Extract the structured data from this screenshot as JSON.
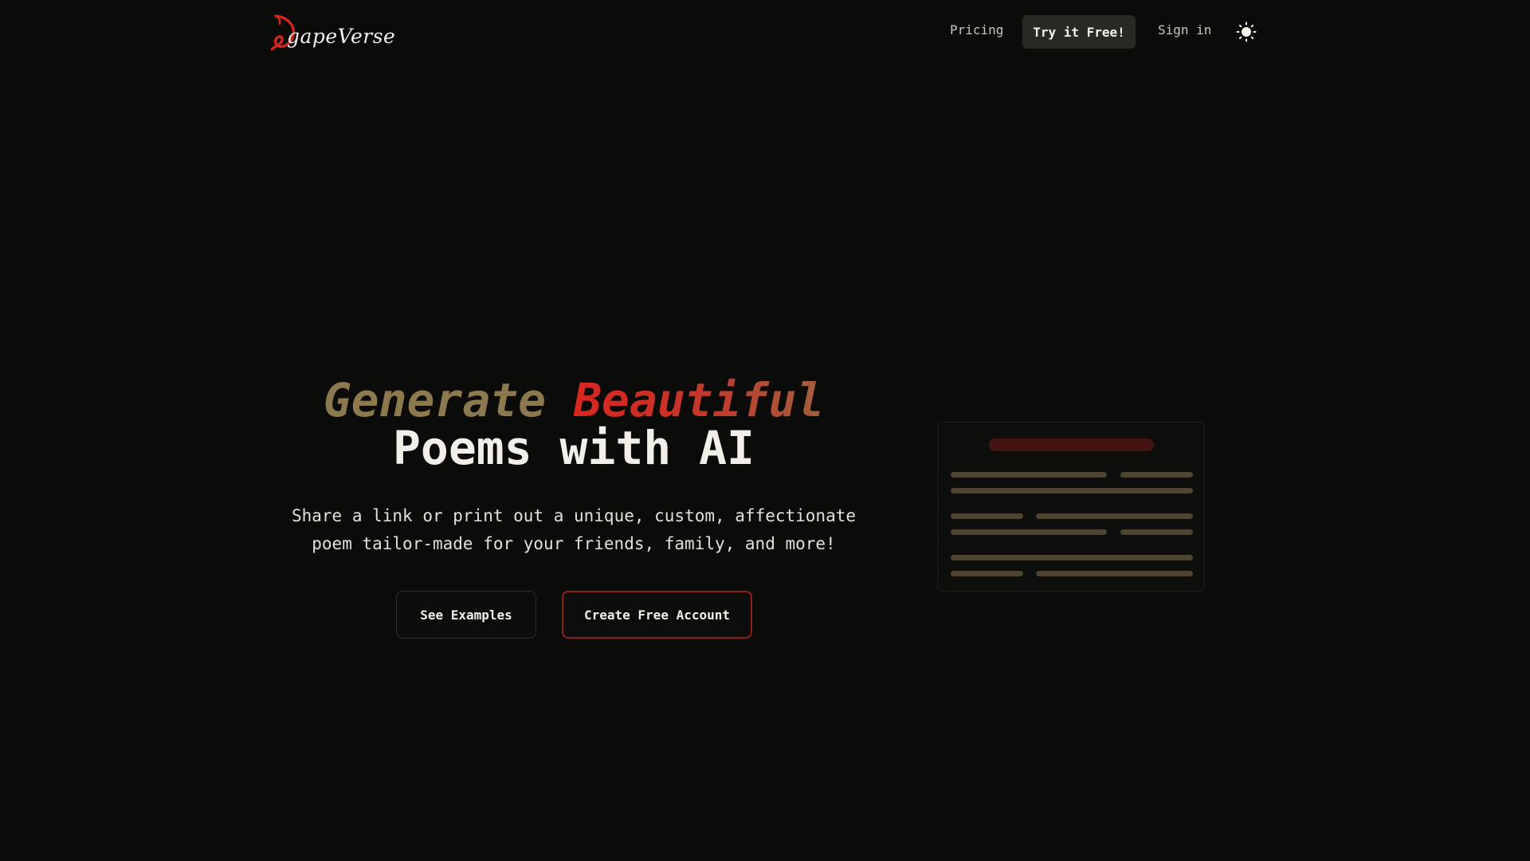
{
  "nav": {
    "logo_text": "gapeVerse",
    "pricing_label": "Pricing",
    "try_label": "Try it Free!",
    "signin_label": "Sign in",
    "theme_icon": "sun-icon"
  },
  "hero": {
    "title_word1": "Generate",
    "title_word2": "Beautiful",
    "title_line2": "Poems with AI",
    "subtitle_line1": "Share a link or print out a unique, custom, affectionate",
    "subtitle_line2": "poem tailor-made for your friends, family, and more!",
    "examples_label": "See Examples",
    "create_label": "Create Free Account"
  },
  "colors": {
    "background": "#0b0b0a",
    "gold": "#8c7a4e",
    "red": "#d8261f",
    "button_dark": "#2a2823",
    "accent_border": "#8e1f1a"
  }
}
